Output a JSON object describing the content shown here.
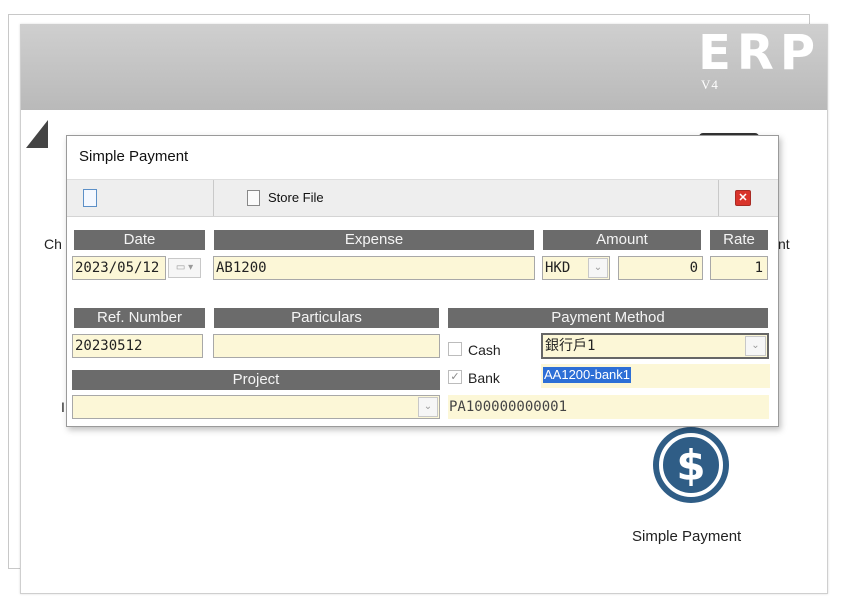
{
  "app": {
    "logo": "ERP",
    "version": "V4",
    "bg_labels": {
      "left_top": "Ch",
      "right_top": "nt",
      "left_mid": "I"
    },
    "simple_payment_label": "Simple Payment",
    "simple_payment_icon": "dollar-circle-icon"
  },
  "dialog": {
    "title": "Simple Payment",
    "toolbar": {
      "new_icon": "new-document-icon",
      "store_file_label": "Store File",
      "store_file_icon": "document-icon",
      "close_icon": "close-icon"
    },
    "headers": {
      "date": "Date",
      "expense": "Expense",
      "amount": "Amount",
      "rate": "Rate",
      "ref_number": "Ref. Number",
      "particulars": "Particulars",
      "payment_method": "Payment Method",
      "project": "Project"
    },
    "fields": {
      "date": "2023/05/12",
      "expense": "AB1200",
      "currency": "HKD",
      "amount": "0",
      "rate": "1",
      "ref_number": "20230512",
      "particulars": "",
      "bank_account": "銀行戶1",
      "bank_code": "AA1200-bank1",
      "project": "",
      "payment_no": "PA100000000001"
    },
    "payment_method": {
      "cash_label": "Cash",
      "cash_checked": false,
      "bank_label": "Bank",
      "bank_checked": true
    }
  },
  "colors": {
    "header_bg": "#6b6b6b",
    "field_bg": "#fcf7d7",
    "close_red": "#d9342b",
    "selection_blue": "#2d6fd6",
    "payment_icon": "#2f5d86"
  }
}
